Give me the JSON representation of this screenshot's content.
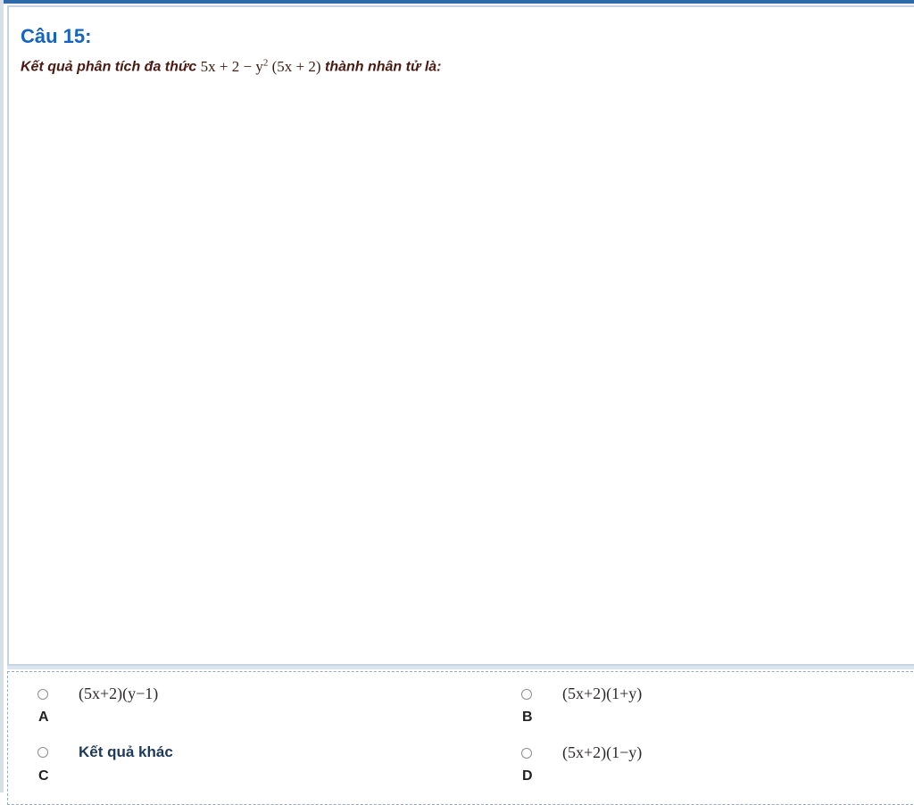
{
  "question": {
    "title": "Câu 15:",
    "prompt_prefix": "Kết quả phân tích đa thức",
    "expression": {
      "part1": "5x + 2 − y",
      "exponent": "2",
      "part2": "(5x + 2)"
    },
    "prompt_suffix": "thành nhân tử là:"
  },
  "options": [
    {
      "letter": "A",
      "text": "(5x+2)(y−1)"
    },
    {
      "letter": "B",
      "text": "(5x+2)(1+y)"
    },
    {
      "letter": "C",
      "text": "Kết quả khác"
    },
    {
      "letter": "D",
      "text": "(5x+2)(1−y)"
    }
  ]
}
